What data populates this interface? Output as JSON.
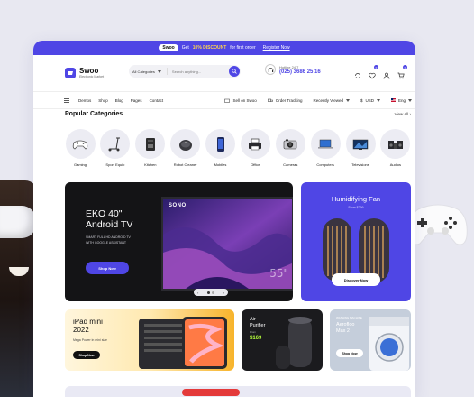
{
  "promo_bar": {
    "badge": "Swoo",
    "text_pre": "Get",
    "highlight": "10% DISCOUNT",
    "text_post": "for first order",
    "link": "Register Now"
  },
  "header": {
    "brand": {
      "name": "Swoo",
      "tagline": "Electronic Market"
    },
    "search": {
      "category": "All Categories",
      "placeholder": "Search anything..."
    },
    "hotline": {
      "label": "Hotline 24/7",
      "number": "(025) 3686 25 16"
    },
    "cart_count": "0",
    "wishlist_count": "0"
  },
  "nav": {
    "items": [
      "Demos",
      "Shop",
      "Blog",
      "Pages",
      "Contact"
    ],
    "right": {
      "sell": "Sell on Swoo",
      "track": "Order Tracking",
      "recent": "Recently Viewed",
      "currency": "USD",
      "language": "Eng"
    }
  },
  "categories": {
    "title": "Popular Categories",
    "view_all": "View All",
    "items": [
      {
        "label": "Gaming",
        "icon": "gamepad-icon"
      },
      {
        "label": "Sport Equip",
        "icon": "scooter-icon"
      },
      {
        "label": "Kitchen",
        "icon": "coffee-machine-icon"
      },
      {
        "label": "Robot Cleaner",
        "icon": "robot-cleaner-icon"
      },
      {
        "label": "Mobiles",
        "icon": "smartphone-icon"
      },
      {
        "label": "Office",
        "icon": "printer-icon"
      },
      {
        "label": "Cameras",
        "icon": "camera-icon"
      },
      {
        "label": "Computers",
        "icon": "laptop-icon"
      },
      {
        "label": "Televisions",
        "icon": "tv-icon"
      },
      {
        "label": "Audios",
        "icon": "speaker-icon"
      }
    ]
  },
  "hero": {
    "title_line1": "EKO 40\"",
    "title_line2": "Android TV",
    "subtitle_line1": "SMART FULL HD ANDROID TV",
    "subtitle_line2": "WITH GOOGLE ASSISTANT",
    "button": "Shop Now",
    "tv_brand": "SONO",
    "tv_size": "55\"",
    "pager": {
      "prev": "‹",
      "next": "›"
    }
  },
  "fan_banner": {
    "title": "Humidifying Fan",
    "price": "From $299",
    "button": "Discover Now"
  },
  "ipad_card": {
    "title_line1": "iPad mini",
    "title_line2": "2022",
    "subtitle": "Mega Power in mini size",
    "button": "Shop Now"
  },
  "air_card": {
    "title_line1": "Air",
    "title_line2": "Purifier",
    "price_label": "From",
    "price": "$169"
  },
  "arctic_card": {
    "caption": "WASHING MACHINE",
    "title_line1": "Aerofloo",
    "title_line2": "Max 2",
    "button": "Shop Now"
  },
  "colors": {
    "accent": "#4f46e5",
    "hero_bg": "#141416",
    "fan_bg": "#4f46e5",
    "promo_highlight": "#ffd44d",
    "price_green": "#b6ff3b"
  }
}
